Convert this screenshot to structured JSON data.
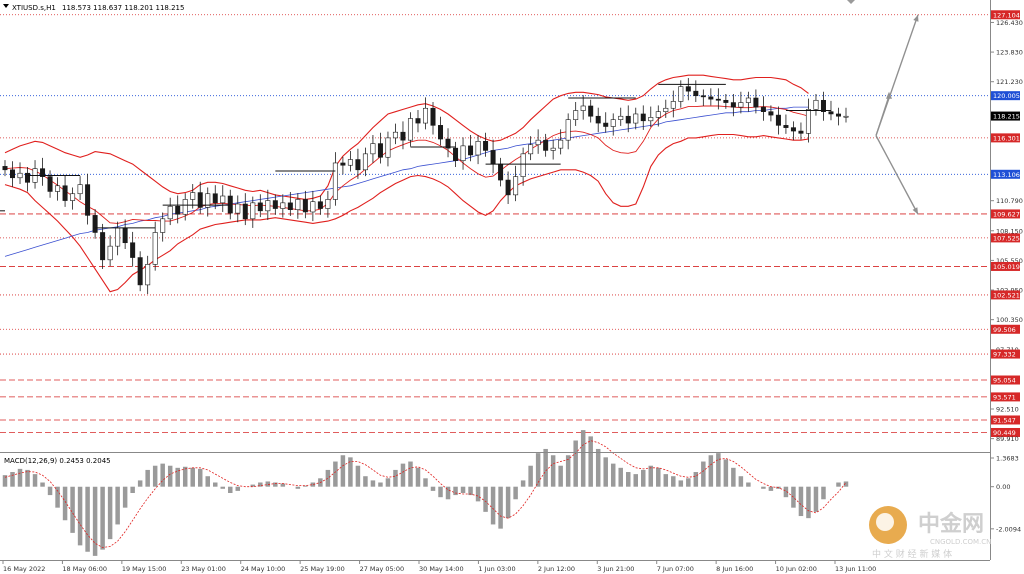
{
  "header": {
    "symbol": "XTIUSD.s,H1",
    "ohlc": "118.573 118.637 118.201 118.215"
  },
  "indicator": {
    "label": "MACD(12,26,9) 0.2453 0.2045",
    "macd_values": [
      0.55,
      0.7,
      0.85,
      0.8,
      0.6,
      0.2,
      -0.4,
      -1.0,
      -1.6,
      -2.2,
      -2.8,
      -3.1,
      -3.3,
      -3.0,
      -2.5,
      -1.8,
      -1.0,
      -0.3,
      0.3,
      0.8,
      1.0,
      1.1,
      1.0,
      0.9,
      0.95,
      0.9,
      0.85,
      0.5,
      0.2,
      -0.1,
      -0.3,
      -0.2,
      0.0,
      0.1,
      0.2,
      0.25,
      0.2,
      0.15,
      0.0,
      -0.1,
      0.05,
      0.2,
      0.4,
      0.8,
      1.2,
      1.5,
      1.4,
      1.0,
      0.5,
      0.3,
      0.2,
      0.4,
      0.8,
      1.1,
      1.2,
      0.9,
      0.4,
      -0.2,
      -0.5,
      -0.6,
      -0.4,
      -0.3,
      -0.4,
      -0.7,
      -1.2,
      -1.8,
      -2.0,
      -1.5,
      -0.6,
      0.3,
      1.0,
      1.6,
      1.8,
      1.5,
      1.0,
      1.5,
      2.2,
      2.7,
      2.4,
      1.8,
      1.4,
      1.1,
      0.9,
      0.7,
      0.6,
      0.8,
      1.0,
      0.9,
      0.6,
      0.5,
      0.3,
      0.4,
      0.7,
      1.2,
      1.5,
      1.6,
      1.3,
      0.9,
      0.5,
      0.2,
      0.0,
      -0.1,
      -0.2,
      -0.1,
      -0.5,
      -1.0,
      -1.4,
      -1.5,
      -1.2,
      -0.6,
      0.0,
      0.2,
      0.25
    ],
    "signal_values": [
      0.45,
      0.55,
      0.65,
      0.72,
      0.7,
      0.55,
      0.25,
      -0.2,
      -0.7,
      -1.25,
      -1.8,
      -2.3,
      -2.7,
      -2.9,
      -2.85,
      -2.6,
      -2.15,
      -1.6,
      -1.05,
      -0.55,
      -0.1,
      0.3,
      0.6,
      0.75,
      0.85,
      0.9,
      0.9,
      0.8,
      0.6,
      0.4,
      0.2,
      0.05,
      0.0,
      0.0,
      0.05,
      0.1,
      0.15,
      0.15,
      0.1,
      0.05,
      0.05,
      0.1,
      0.2,
      0.4,
      0.7,
      1.0,
      1.2,
      1.2,
      1.05,
      0.8,
      0.55,
      0.45,
      0.5,
      0.7,
      0.9,
      0.95,
      0.8,
      0.5,
      0.15,
      -0.15,
      -0.3,
      -0.35,
      -0.35,
      -0.45,
      -0.7,
      -1.05,
      -1.4,
      -1.5,
      -1.3,
      -0.9,
      -0.4,
      0.2,
      0.75,
      1.1,
      1.2,
      1.3,
      1.6,
      2.0,
      2.2,
      2.1,
      1.9,
      1.6,
      1.35,
      1.1,
      0.9,
      0.85,
      0.9,
      0.9,
      0.8,
      0.65,
      0.5,
      0.45,
      0.5,
      0.75,
      1.05,
      1.3,
      1.35,
      1.2,
      0.95,
      0.65,
      0.35,
      0.15,
      0.0,
      -0.05,
      -0.2,
      -0.5,
      -0.85,
      -1.15,
      -1.25,
      -1.0,
      -0.6,
      -0.25,
      0.2
    ]
  },
  "price_labels": [
    {
      "value": "127.104",
      "price": 127.104,
      "color": "#d62828",
      "style": "dotted",
      "boxed": true
    },
    {
      "value": "126.430",
      "price": 126.43,
      "boxed": false
    },
    {
      "value": "123.830",
      "price": 123.83,
      "boxed": false
    },
    {
      "value": "121.230",
      "price": 121.23,
      "boxed": false
    },
    {
      "value": "120.005",
      "price": 120.005,
      "color": "#1f4fd6",
      "style": "dotted",
      "boxed": true
    },
    {
      "value": "118.215",
      "price": 118.215,
      "color": "#000000",
      "style": "none",
      "boxed": true
    },
    {
      "value": "116.301",
      "price": 116.301,
      "color": "#d62828",
      "style": "dotted",
      "boxed": true
    },
    {
      "value": "113.106",
      "price": 113.106,
      "color": "#1f4fd6",
      "style": "dotted",
      "boxed": true
    },
    {
      "value": "110.790",
      "price": 110.79,
      "boxed": false
    },
    {
      "value": "109.627",
      "price": 109.627,
      "color": "#d62828",
      "style": "dashed",
      "boxed": true
    },
    {
      "value": "108.150",
      "price": 108.15,
      "boxed": false
    },
    {
      "value": "107.525",
      "price": 107.525,
      "color": "#d62828",
      "style": "dotted",
      "boxed": true
    },
    {
      "value": "105.550",
      "price": 105.55,
      "boxed": false
    },
    {
      "value": "105.019",
      "price": 105.019,
      "color": "#d62828",
      "style": "dashed",
      "boxed": true
    },
    {
      "value": "102.950",
      "price": 102.95,
      "boxed": false
    },
    {
      "value": "102.521",
      "price": 102.521,
      "color": "#d62828",
      "style": "dotted",
      "boxed": true
    },
    {
      "value": "100.350",
      "price": 100.35,
      "boxed": false
    },
    {
      "value": "99.506",
      "price": 99.506,
      "color": "#d62828",
      "style": "dotted",
      "boxed": true
    },
    {
      "value": "97.710",
      "price": 97.71,
      "boxed": false
    },
    {
      "value": "97.332",
      "price": 97.332,
      "color": "#d62828",
      "style": "dotted",
      "boxed": true
    },
    {
      "value": "95.054",
      "price": 95.054,
      "color": "#d62828",
      "style": "dashed",
      "boxed": true
    },
    {
      "value": "93.571",
      "price": 93.571,
      "color": "#d62828",
      "style": "dashed",
      "boxed": true
    },
    {
      "value": "92.510",
      "price": 92.51,
      "boxed": false
    },
    {
      "value": "91.547",
      "price": 91.547,
      "color": "#d62828",
      "style": "dashed",
      "boxed": true
    },
    {
      "value": "90.449",
      "price": 90.449,
      "color": "#d62828",
      "style": "dashed",
      "boxed": true
    },
    {
      "value": "89.910",
      "price": 89.91,
      "boxed": false
    }
  ],
  "macd_axis": [
    {
      "value": "1.3683",
      "v": 1.3683
    },
    {
      "value": "0.00",
      "v": 0.0
    },
    {
      "value": "-2.0094",
      "v": -2.0094
    }
  ],
  "time_labels": [
    "16 May 2022",
    "18 May 06:00",
    "19 May 15:00",
    "23 May 01:00",
    "24 May 10:00",
    "25 May 19:00",
    "27 May 05:00",
    "30 May 14:00",
    "1 Jun 03:00",
    "2 Jun 12:00",
    "3 Jun 21:00",
    "7 Jun 07:00",
    "8 Jun 16:00",
    "10 Jun 02:00",
    "13 Jun 11:00"
  ],
  "watermark": {
    "brand": "中金网",
    "domain": "CNGOLD.COM.CN",
    "slogan": "中 文 财 经 新 媒 体"
  },
  "colors": {
    "band": "#e0201e",
    "ma": "#3a4fd0",
    "candle": "#1a1a1a",
    "histogram": "#9a9a9a",
    "signal": "#e0201e",
    "arrow": "#909090"
  },
  "chart_data": {
    "type": "candlestick",
    "symbol": "XTIUSD.s,H1",
    "ylim": [
      89.0,
      128.4
    ],
    "close": [
      113.5,
      112.8,
      113.2,
      112.4,
      113.6,
      112.9,
      111.6,
      112.1,
      110.8,
      111.4,
      112.2,
      109.5,
      108.0,
      105.6,
      106.8,
      108.4,
      107.1,
      105.8,
      103.4,
      105.2,
      108.0,
      109.2,
      110.3,
      109.6,
      110.9,
      111.5,
      110.2,
      111.4,
      110.6,
      111.2,
      109.7,
      110.5,
      109.2,
      110.6,
      109.9,
      110.8,
      110.1,
      110.6,
      110.0,
      110.9,
      109.8,
      110.7,
      110.1,
      110.9,
      114.1,
      113.9,
      114.4,
      113.5,
      114.9,
      115.8,
      114.6,
      116.3,
      116.8,
      116.1,
      118.0,
      117.6,
      118.9,
      117.4,
      116.2,
      115.4,
      114.3,
      115.6,
      114.8,
      116.0,
      115.2,
      114.0,
      112.6,
      111.3,
      112.9,
      114.9,
      115.7,
      116.1,
      115.2,
      115.4,
      116.1,
      117.9,
      118.7,
      119.1,
      118.2,
      117.6,
      117.3,
      117.9,
      118.2,
      117.6,
      118.4,
      117.8,
      118.1,
      118.6,
      118.9,
      119.5,
      120.8,
      120.4,
      120.0,
      119.9,
      119.7,
      119.6,
      119.4,
      119.0,
      119.4,
      119.8,
      119.0,
      118.6,
      118.3,
      117.4,
      117.2,
      116.9,
      116.7,
      118.8,
      119.6,
      118.6,
      118.4,
      118.2,
      118.2
    ],
    "upper_band": [
      115.0,
      115.3,
      115.6,
      115.8,
      116.0,
      115.9,
      115.6,
      115.3,
      115.0,
      114.8,
      114.6,
      114.8,
      115.1,
      115.0,
      114.9,
      114.6,
      114.3,
      114.0,
      113.5,
      113.0,
      112.5,
      112.0,
      111.6,
      111.4,
      111.5,
      111.7,
      112.2,
      112.4,
      112.4,
      112.3,
      112.1,
      111.9,
      111.7,
      111.6,
      111.7,
      111.5,
      111.3,
      111.2,
      111.1,
      111.0,
      110.9,
      111.0,
      111.2,
      112.1,
      113.8,
      114.7,
      115.3,
      115.8,
      116.5,
      117.2,
      117.8,
      118.4,
      118.6,
      118.8,
      119.0,
      119.2,
      119.3,
      119.1,
      118.8,
      118.4,
      117.9,
      117.4,
      116.9,
      116.5,
      116.2,
      116.0,
      116.1,
      116.4,
      116.7,
      117.2,
      117.9,
      118.5,
      119.1,
      119.7,
      120.0,
      120.2,
      120.3,
      120.3,
      120.2,
      120.1,
      119.9,
      119.8,
      119.7,
      119.6,
      119.7,
      120.0,
      120.6,
      121.1,
      121.4,
      121.6,
      121.7,
      121.8,
      121.8,
      121.8,
      121.7,
      121.6,
      121.5,
      121.4,
      121.4,
      121.5,
      121.6,
      121.6,
      121.6,
      121.5,
      121.4,
      121.0,
      120.7,
      120.2
    ],
    "lower_band": [
      112.2,
      112.0,
      111.8,
      111.5,
      110.8,
      110.2,
      109.6,
      109.0,
      108.3,
      107.6,
      106.8,
      105.8,
      104.8,
      103.8,
      102.8,
      103.0,
      103.6,
      104.3,
      104.7,
      105.1,
      105.6,
      106.0,
      106.4,
      107.0,
      107.4,
      107.8,
      108.3,
      108.5,
      108.7,
      108.8,
      108.9,
      109.0,
      109.1,
      109.1,
      109.1,
      109.2,
      109.3,
      109.2,
      109.1,
      109.0,
      108.9,
      108.8,
      108.9,
      109.0,
      109.2,
      109.5,
      109.9,
      110.2,
      110.6,
      111.0,
      111.5,
      111.9,
      112.3,
      112.6,
      112.9,
      113.0,
      112.9,
      112.7,
      112.4,
      112.0,
      111.4,
      110.8,
      110.3,
      109.8,
      109.5,
      109.9,
      110.8,
      111.5,
      112.1,
      112.4,
      112.7,
      112.9,
      113.1,
      113.3,
      113.5,
      113.5,
      113.5,
      113.3,
      113.0,
      112.5,
      111.4,
      110.6,
      110.3,
      110.3,
      110.5,
      112.0,
      113.8,
      114.8,
      115.4,
      115.8,
      116.0,
      116.3,
      116.3,
      116.4,
      116.5,
      116.6,
      116.6,
      116.6,
      116.5,
      116.4,
      116.4,
      116.5,
      116.4,
      116.3,
      116.2,
      116.1,
      116.1,
      116.2
    ],
    "ma": [
      105.9,
      106.1,
      106.3,
      106.5,
      106.7,
      106.9,
      107.1,
      107.3,
      107.5,
      107.7,
      107.9,
      108.0,
      108.2,
      108.3,
      108.4,
      108.5,
      108.7,
      108.8,
      109.0,
      109.1,
      109.3,
      109.4,
      109.6,
      109.7,
      109.8,
      109.9,
      110.0,
      110.2,
      110.3,
      110.4,
      110.5,
      110.6,
      110.7,
      110.8,
      110.9,
      111.0,
      111.1,
      111.2,
      111.3,
      111.4,
      111.5,
      111.6,
      111.7,
      111.8,
      111.9,
      112.0,
      112.1,
      112.3,
      112.5,
      112.7,
      112.9,
      113.1,
      113.3,
      113.5,
      113.6,
      113.8,
      113.9,
      114.0,
      114.1,
      114.2,
      114.3,
      114.4,
      114.6,
      114.8,
      115.0,
      115.2,
      115.3,
      115.4,
      115.6,
      115.7,
      115.8,
      115.9,
      116.0,
      116.1,
      116.2,
      116.3,
      116.4,
      116.5,
      116.6,
      116.7,
      116.8,
      116.9,
      117.0,
      117.1,
      117.2,
      117.3,
      117.4,
      117.5,
      117.7,
      117.8,
      117.9,
      118.0,
      118.1,
      118.2,
      118.3,
      118.4,
      118.5,
      118.5,
      118.6,
      118.6,
      118.7,
      118.7,
      118.8,
      118.9,
      118.9,
      119.0,
      119.0,
      119.0
    ],
    "projection_arrows": [
      {
        "from": [
          116.5,
          0
        ],
        "to": [
          127.1,
          1
        ]
      },
      {
        "from": [
          116.5,
          0
        ],
        "to": [
          109.6,
          1
        ]
      }
    ]
  }
}
